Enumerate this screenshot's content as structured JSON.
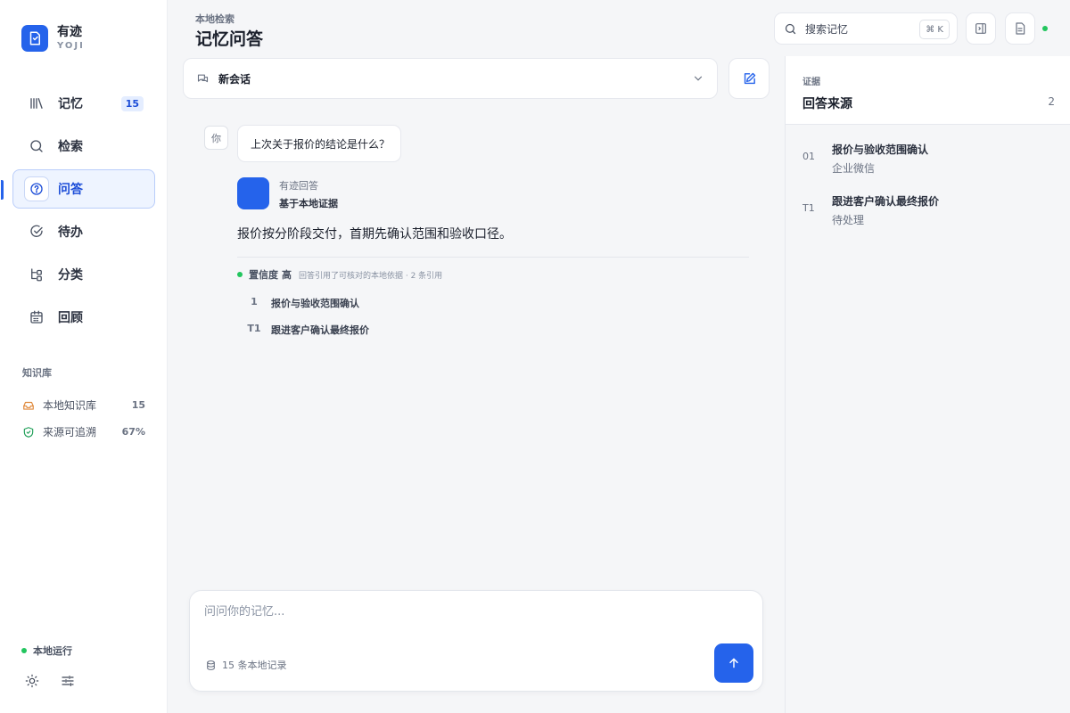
{
  "brand": {
    "name": "有迹",
    "sub": "YOJI"
  },
  "nav": [
    {
      "label": "记忆",
      "badge": "15"
    },
    {
      "label": "检索"
    },
    {
      "label": "问答"
    },
    {
      "label": "待办"
    },
    {
      "label": "分类"
    },
    {
      "label": "回顾"
    }
  ],
  "knowledge_base": {
    "title": "知识库",
    "rows": [
      {
        "label": "本地知识库",
        "value": "15"
      },
      {
        "label": "来源可追溯",
        "value": "67%"
      }
    ]
  },
  "status": {
    "label": "本地运行"
  },
  "header": {
    "crumb": "本地检索",
    "title": "记忆问答",
    "search_label": "搜索记忆",
    "search_shortcut": "⌘ K"
  },
  "conversation": {
    "label": "新会话"
  },
  "chat": {
    "user_avatar": "你",
    "user_message": "上次关于报价的结论是什么？",
    "bot_name": "有迹回答",
    "bot_basis": "基于本地证据",
    "answer": "报价按分阶段交付，首期先确认范围和验收口径。",
    "confidence_label": "置信度",
    "confidence_level": "高",
    "confidence_note": "回答引用了可核对的本地依据 · 2 条引用",
    "citations": [
      {
        "id": "1",
        "title": "报价与验收范围确认"
      },
      {
        "id": "T1",
        "title": "跟进客户确认最终报价"
      }
    ]
  },
  "composer": {
    "placeholder": "问问你的记忆...",
    "meta": "15 条本地记录"
  },
  "evidence": {
    "eyebrow": "证据",
    "title": "回答来源",
    "count": "2",
    "items": [
      {
        "id": "01",
        "title": "报价与验收范围确认",
        "source": "企业微信"
      },
      {
        "id": "T1",
        "title": "跟进客户确认最终报价",
        "source": "待处理"
      }
    ]
  },
  "colors": {
    "accent": "#2563eb",
    "status_green": "#22c55e"
  }
}
